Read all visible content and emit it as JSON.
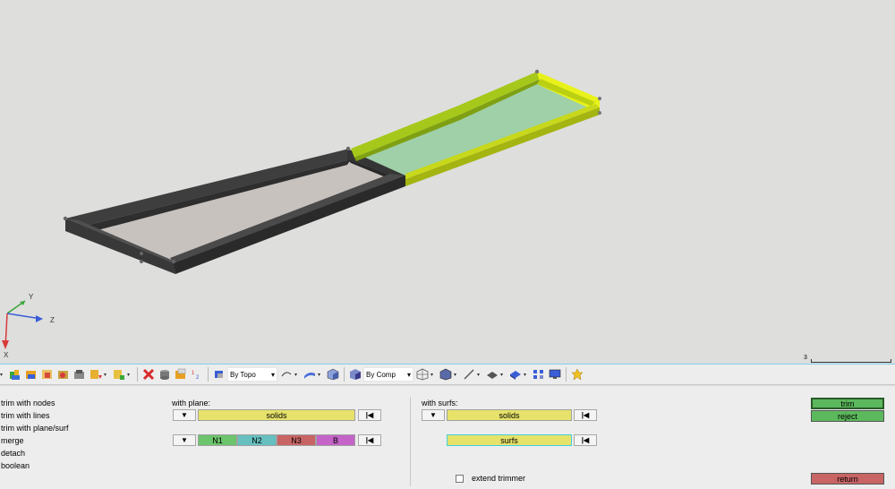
{
  "viewport": {
    "axes": {
      "y": "Y",
      "z": "Z",
      "x": "X"
    },
    "scale_label": "3"
  },
  "toolbar": {
    "topo_select": "By Topo",
    "comp_select": "By Comp",
    "icons": [
      "collector-icon",
      "comps-icon",
      "display-icon",
      "mask-icon",
      "import-icon",
      "export-icon",
      "delete-icon",
      "cylinder-icon",
      "box-icon",
      "numbers-icon",
      "view-icon",
      "rotate-icon",
      "surface-icon",
      "cube-icon",
      "wireframe-icon",
      "shaded-icon",
      "line-icon",
      "plane-icon",
      "solid-icon",
      "connectors-icon",
      "monitor-icon",
      "star-icon"
    ]
  },
  "menu": {
    "items": [
      "trim with nodes",
      "trim with lines",
      "trim with plane/surf",
      "merge",
      "detach",
      "boolean"
    ]
  },
  "with_plane": {
    "label": "with plane:",
    "solids": "solids",
    "n1": "N1",
    "n2": "N2",
    "n3": "N3",
    "b": "B"
  },
  "with_surfs": {
    "label": "with surfs:",
    "solids": "solids",
    "surfs": "surfs",
    "extend_trimmer": "extend trimmer"
  },
  "actions": {
    "trim": "trim",
    "reject": "reject",
    "return": "return"
  },
  "colors": {
    "collector_yellow": "#e6e26a",
    "n1": "#6cc46c",
    "n2": "#66c0c0",
    "n3": "#c86464",
    "b": "#c464c8",
    "green_btn": "#5cb85c",
    "return_btn": "#c86464",
    "dark_solid": "#444444",
    "bright_solid": "#d8e61a"
  }
}
